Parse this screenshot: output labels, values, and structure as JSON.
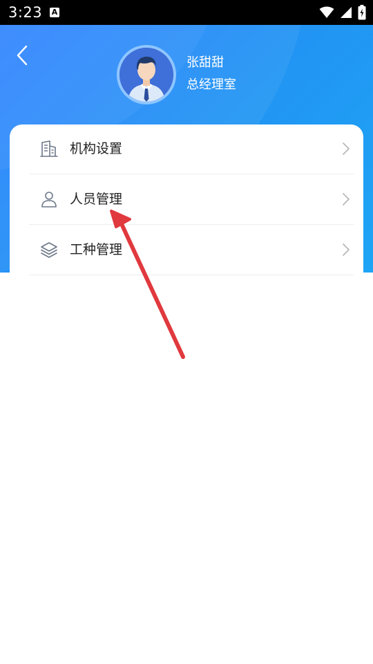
{
  "status_bar": {
    "time": "3:23",
    "a_icon_label": "A",
    "icons": [
      "wifi-icon",
      "signal-icon",
      "battery-icon"
    ]
  },
  "header": {
    "back_icon": "chevron-left-icon",
    "user_name": "张甜甜",
    "user_title": "总经理室"
  },
  "menu": {
    "items": [
      {
        "label": "机构设置",
        "icon": "building-icon"
      },
      {
        "label": "人员管理",
        "icon": "person-icon"
      },
      {
        "label": "工种管理",
        "icon": "layers-icon"
      }
    ]
  },
  "colors": {
    "header_gradient_start": "#2a7fff",
    "header_gradient_end": "#1ea5f5",
    "text_primary": "#222222",
    "icon_stroke": "#6b7788",
    "chevron": "#b8b8b8",
    "annotation_arrow": "#e0393e"
  }
}
